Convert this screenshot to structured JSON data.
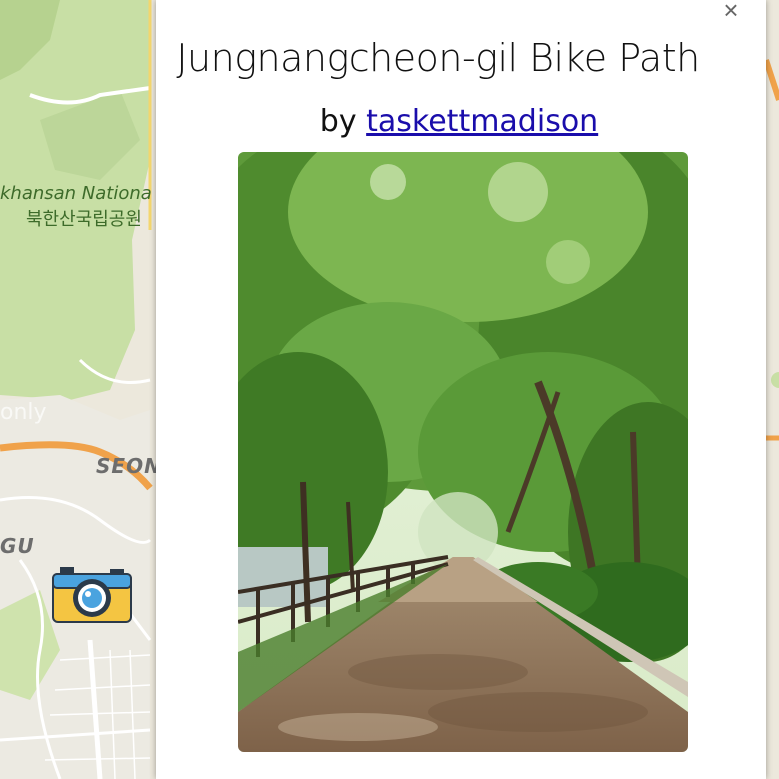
{
  "popup": {
    "title": "Jungnangcheon-gil Bike Path",
    "by_prefix": "by",
    "author": "taskettmadison",
    "close_label": "×",
    "photo_alt": "Tree-lined path"
  },
  "map": {
    "labels": {
      "park_en": "khansan Nationa",
      "park_ko": "북한산국립공원",
      "district_1": "SEON",
      "district_2": "GU",
      "watermark": "only"
    },
    "marker_icon": "camera-icon"
  },
  "colors": {
    "road_orange": "#f0a24a",
    "park_green": "#c8dfa5",
    "map_base": "#ece8dc",
    "link": "#1a0dab"
  }
}
